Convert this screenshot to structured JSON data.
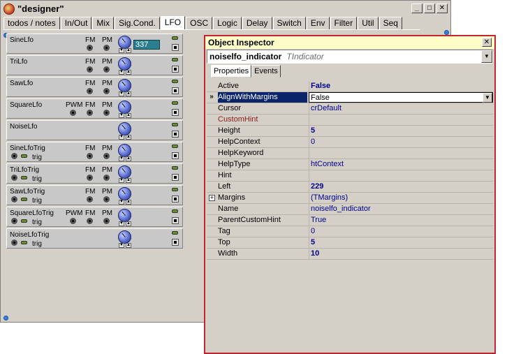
{
  "designer": {
    "title": "\"designer\"",
    "tabs": [
      "todos / notes",
      "In/Out",
      "Mix",
      "Sig.Cond.",
      "LFO",
      "OSC",
      "Logic",
      "Delay",
      "Switch",
      "Env",
      "Filter",
      "Util",
      "Seq"
    ],
    "active_tab": "LFO",
    "value_box": "337",
    "modules": [
      {
        "name": "SineLfo",
        "labels": [
          "FM",
          "PM"
        ],
        "trig": ""
      },
      {
        "name": "TriLfo",
        "labels": [
          "FM",
          "PM"
        ],
        "trig": ""
      },
      {
        "name": "SawLfo",
        "labels": [
          "FM",
          "PM"
        ],
        "trig": ""
      },
      {
        "name": "SquareLfo",
        "labels": [
          "PWM",
          "FM",
          "PM"
        ],
        "trig": ""
      },
      {
        "name": "NoiseLfo",
        "labels": [],
        "trig": ""
      },
      {
        "name": "SineLfoTrig",
        "labels": [
          "FM",
          "PM"
        ],
        "trig": "trig"
      },
      {
        "name": "TriLfoTrig",
        "labels": [
          "FM",
          "PM"
        ],
        "trig": "trig"
      },
      {
        "name": "SawLfoTrig",
        "labels": [
          "FM",
          "PM"
        ],
        "trig": "trig"
      },
      {
        "name": "SquareLfoTrig",
        "labels": [
          "PWM",
          "FM",
          "PM"
        ],
        "trig": "trig"
      },
      {
        "name": "NoiseLfoTrig",
        "labels": [],
        "trig": "trig"
      }
    ]
  },
  "inspector": {
    "title": "Object Inspector",
    "object_name": "noiselfo_indicator",
    "object_type": "TIndicator",
    "tabs": [
      "Properties",
      "Events"
    ],
    "properties": [
      {
        "name": "Active",
        "value": "False",
        "bold": true
      },
      {
        "name": "AlignWithMargins",
        "value": "False",
        "selected": true
      },
      {
        "name": "Cursor",
        "value": "crDefault"
      },
      {
        "name": "CustomHint",
        "value": "",
        "custom": true
      },
      {
        "name": "Height",
        "value": "5",
        "bold": true
      },
      {
        "name": "HelpContext",
        "value": "0"
      },
      {
        "name": "HelpKeyword",
        "value": ""
      },
      {
        "name": "HelpType",
        "value": "htContext"
      },
      {
        "name": "Hint",
        "value": ""
      },
      {
        "name": "Left",
        "value": "229",
        "bold": true
      },
      {
        "name": "Margins",
        "value": "(TMargins)",
        "expandable": true
      },
      {
        "name": "Name",
        "value": "noiselfo_indicator"
      },
      {
        "name": "ParentCustomHint",
        "value": "True"
      },
      {
        "name": "Tag",
        "value": "0"
      },
      {
        "name": "Top",
        "value": "5",
        "bold": true
      },
      {
        "name": "Width",
        "value": "10",
        "bold": true
      }
    ]
  }
}
